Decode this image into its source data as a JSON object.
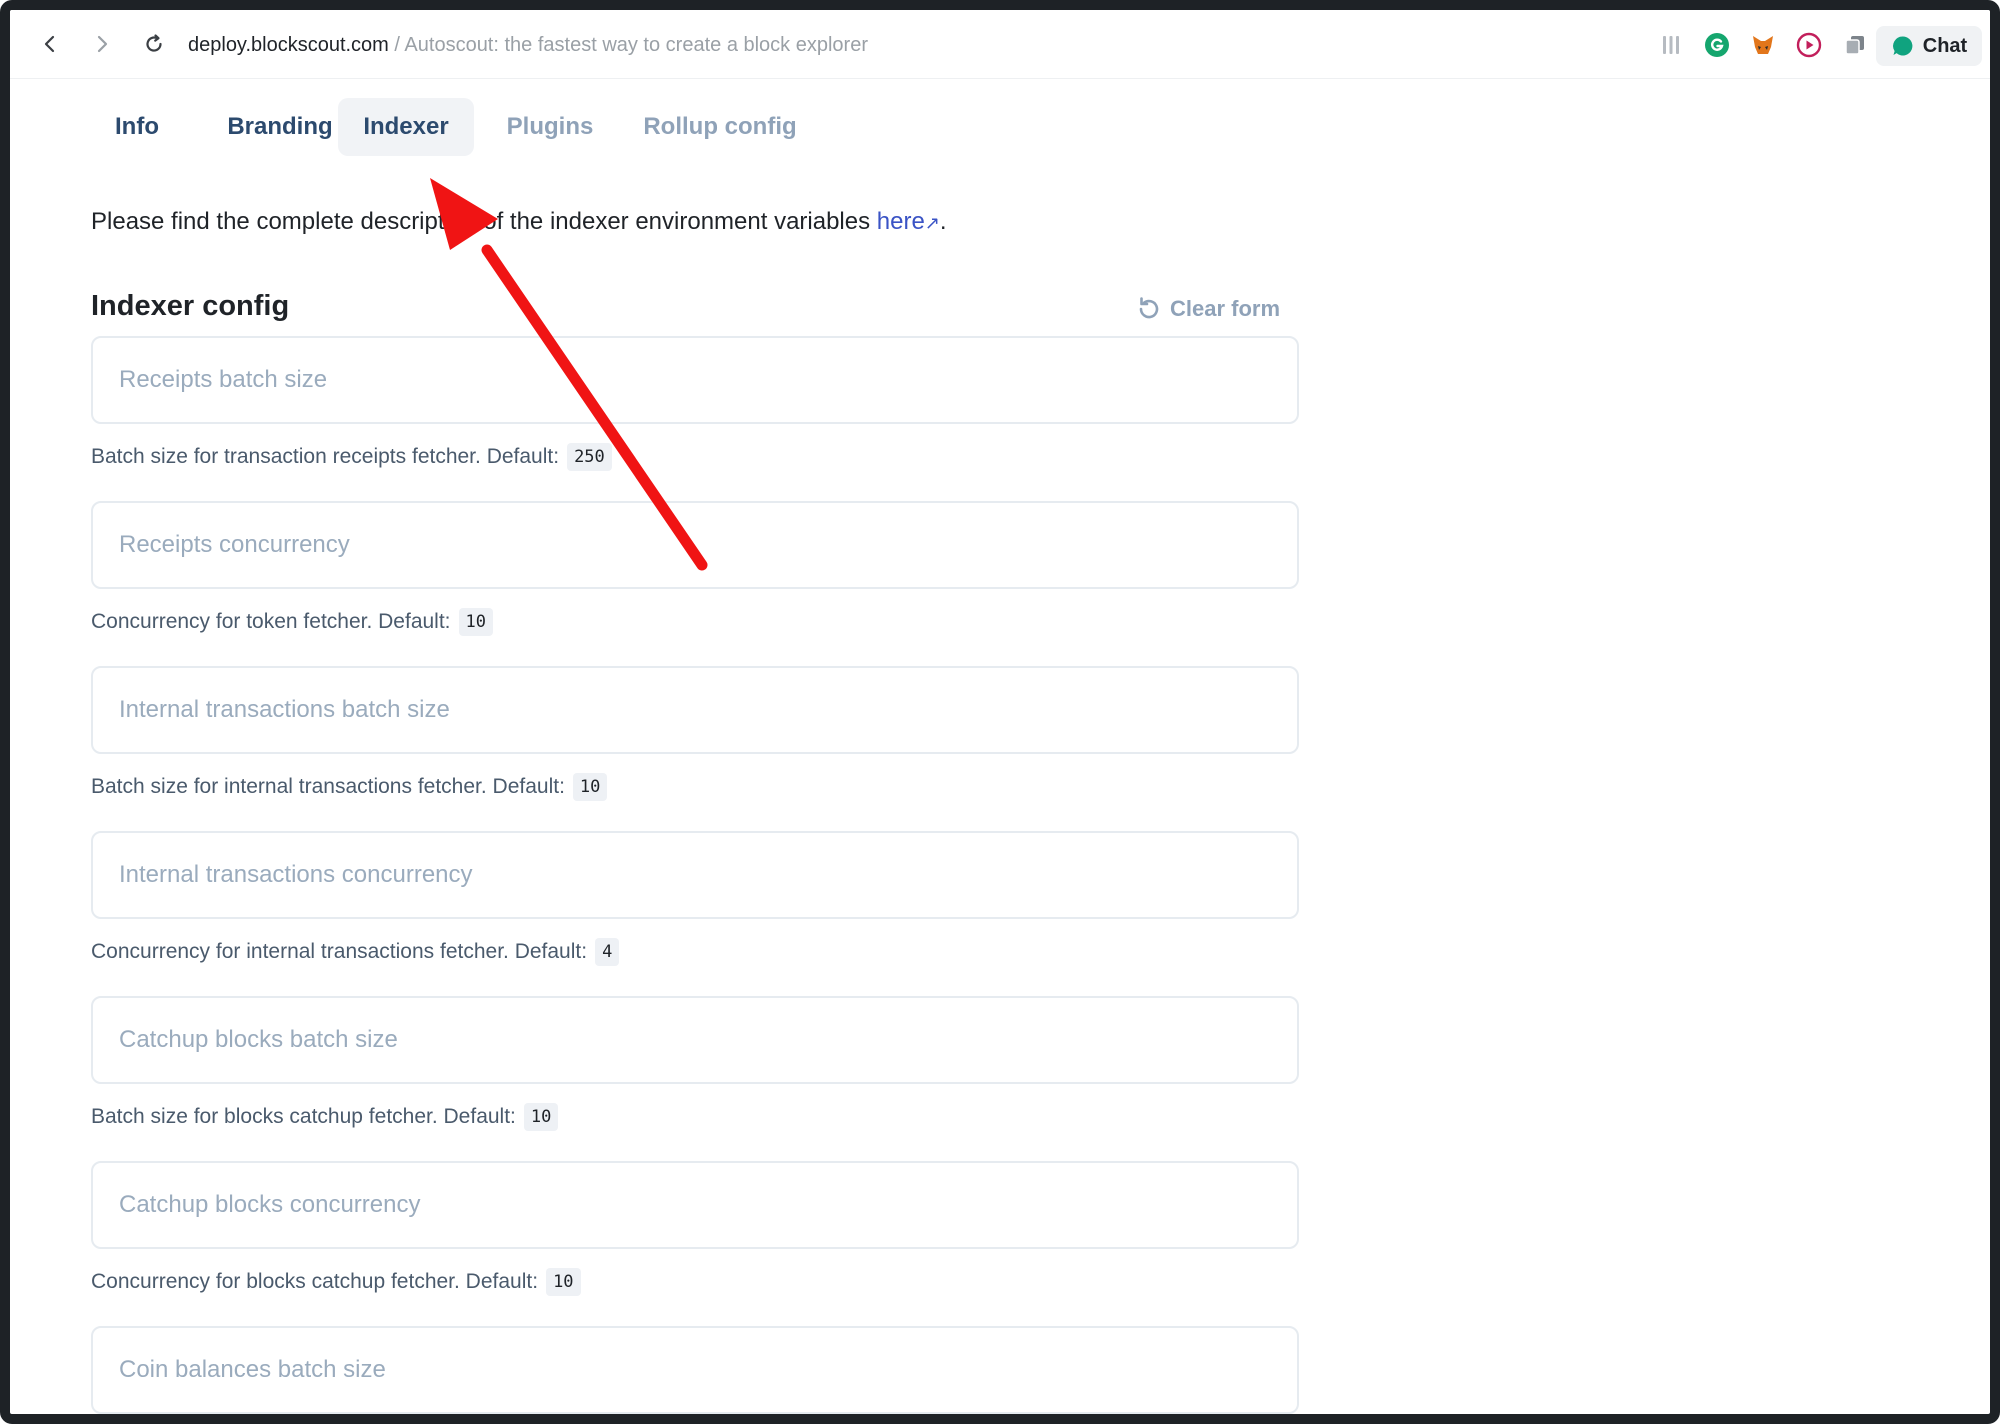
{
  "browser": {
    "domain": "deploy.blockscout.com",
    "separator": " / ",
    "page_title": "Autoscout: the fastest way to create a block explorer",
    "extensions": [
      "tools-icon",
      "grammarly-icon",
      "metamask-icon",
      "screen-recorder-icon",
      "copy-extension-icon"
    ],
    "chat_label": "Chat"
  },
  "tabs": [
    {
      "label": "Info"
    },
    {
      "label": "Branding"
    },
    {
      "label": "Indexer",
      "active": true
    },
    {
      "label": "Plugins"
    },
    {
      "label": "Rollup config"
    }
  ],
  "description": {
    "text": "Please find the complete description of the indexer environment variables ",
    "link": "here",
    "link_icon": "↗",
    "end": "."
  },
  "section": {
    "title": "Indexer config",
    "clear_form": "Clear form"
  },
  "fields": [
    {
      "placeholder": "Receipts batch size",
      "hint": "Batch size for transaction receipts fetcher. Default:",
      "default": "250"
    },
    {
      "placeholder": "Receipts concurrency",
      "hint": "Concurrency for token fetcher. Default:",
      "default": "10"
    },
    {
      "placeholder": "Internal transactions batch size",
      "hint": "Batch size for internal transactions fetcher. Default:",
      "default": "10"
    },
    {
      "placeholder": "Internal transactions concurrency",
      "hint": "Concurrency for internal transactions fetcher. Default:",
      "default": "4"
    },
    {
      "placeholder": "Catchup blocks batch size",
      "hint": "Batch size for blocks catchup fetcher. Default:",
      "default": "10"
    },
    {
      "placeholder": "Catchup blocks concurrency",
      "hint": "Concurrency for blocks catchup fetcher. Default:",
      "default": "10"
    },
    {
      "placeholder": "Coin balances batch size"
    }
  ],
  "colors": {
    "arrow": "#f01414",
    "link": "#3a53c5",
    "tab_dark": "#2c4a6e",
    "tab_light": "#8fa2b8"
  }
}
